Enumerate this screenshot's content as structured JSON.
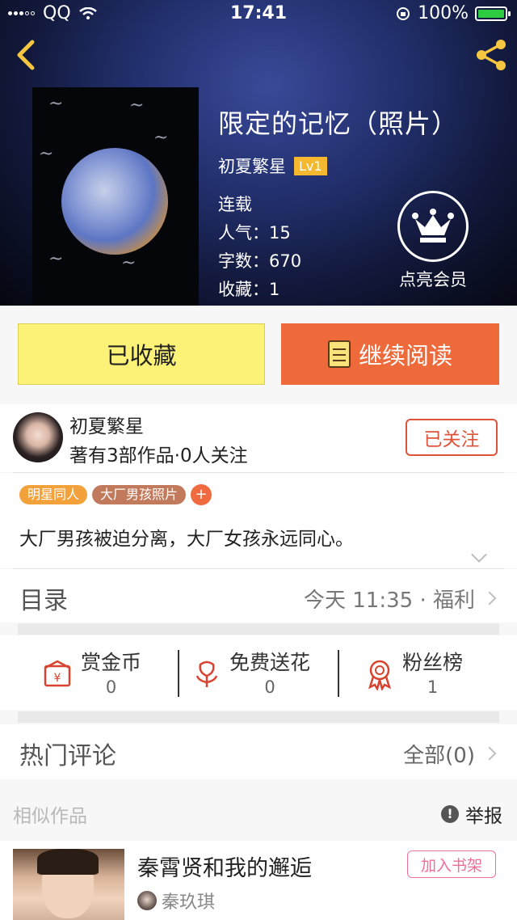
{
  "statusbar": {
    "carrier": "QQ",
    "time": "17:41",
    "battery": "100%"
  },
  "book": {
    "title": "限定的记忆（照片）",
    "author": "初夏繁星",
    "level": "Lv1",
    "status": "连载",
    "popularity_label": "人气：",
    "popularity": "15",
    "words_label": "字数：",
    "words": "670",
    "favorites_label": "收藏：",
    "favorites": "1",
    "vip_label": "点亮会员"
  },
  "actions": {
    "favorited": "已收藏",
    "continue_read": "继续阅读"
  },
  "author": {
    "name": "初夏繁星",
    "summary": "著有3部作品·0人关注",
    "follow_state": "已关注"
  },
  "tags": [
    "明星同人",
    "大厂男孩照片"
  ],
  "tag_add": "+",
  "description": "大厂男孩被迫分离，大厂女孩永远同心。",
  "catalog": {
    "label": "目录",
    "latest": "今天 11:35 · 福利"
  },
  "stats": [
    {
      "label": "赏金币",
      "value": "0",
      "icon": "coin-envelope-icon"
    },
    {
      "label": "免费送花",
      "value": "0",
      "icon": "flower-icon"
    },
    {
      "label": "粉丝榜",
      "value": "1",
      "icon": "medal-icon"
    }
  ],
  "comments": {
    "label": "热门评论",
    "all": "全部(0)"
  },
  "similar": {
    "label": "相似作品",
    "report": "举报",
    "items": [
      {
        "title": "秦霄贤和我的邂逅",
        "author": "秦玖琪",
        "add_label": "加入书架"
      }
    ]
  },
  "colors": {
    "accent_orange": "#ee6a3b",
    "fav_yellow": "#fdf278",
    "follow_red": "#e0533b",
    "shelf_pink": "#ee6e9a",
    "level_gold": "#f5b82e"
  }
}
